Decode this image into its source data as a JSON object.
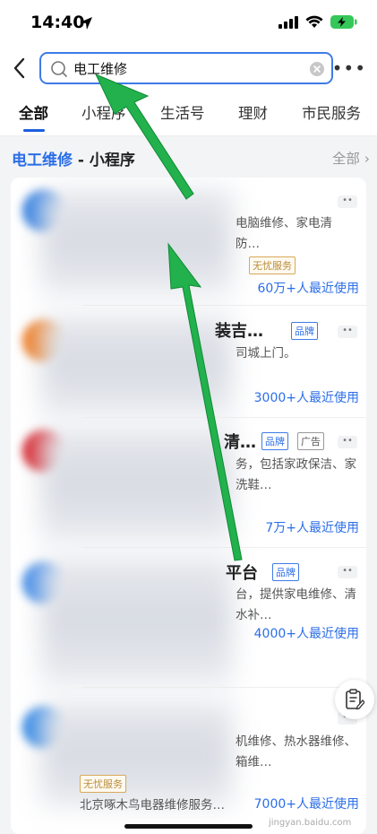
{
  "status_bar": {
    "time": "14:40"
  },
  "search": {
    "query": "电工维修"
  },
  "tabs": [
    {
      "label": "全部"
    },
    {
      "label": "小程序"
    },
    {
      "label": "生活号"
    },
    {
      "label": "理财"
    },
    {
      "label": "市民服务"
    }
  ],
  "section": {
    "keyword": "电工维修",
    "title_suffix": " - 小程序",
    "all_label": "全部"
  },
  "results": [
    {
      "desc": [
        "电脑维修、家电清",
        "防…"
      ],
      "badges": [
        "无忧服务"
      ],
      "usage": "60万+人最近使用"
    },
    {
      "name_visible": "装吉…",
      "badges": [
        "品牌"
      ],
      "desc": [
        "司城上门。"
      ],
      "usage": "3000+人最近使用"
    },
    {
      "name_visible": "清…",
      "badges": [
        "品牌",
        "广告"
      ],
      "desc": [
        "务，包括家政保洁、家",
        "洗鞋…"
      ],
      "usage": "7万+人最近使用"
    },
    {
      "name_visible": "平台",
      "badges": [
        "品牌"
      ],
      "desc": [
        "台，提供家电维修、清",
        "水补…"
      ],
      "usage": "4000+人最近使用"
    },
    {
      "desc": [
        "机维修、热水器维修、",
        "箱维…"
      ],
      "badges": [
        "无忧服务"
      ],
      "footer": "北京啄木鸟电器维修服务…",
      "usage": "7000+人最近使用"
    }
  ],
  "watermark": "jingyan.baidu.com",
  "colors": {
    "accent": "#2b6ee8",
    "annotation_arrow": "#22b14c",
    "background": "#f3f4f6"
  }
}
